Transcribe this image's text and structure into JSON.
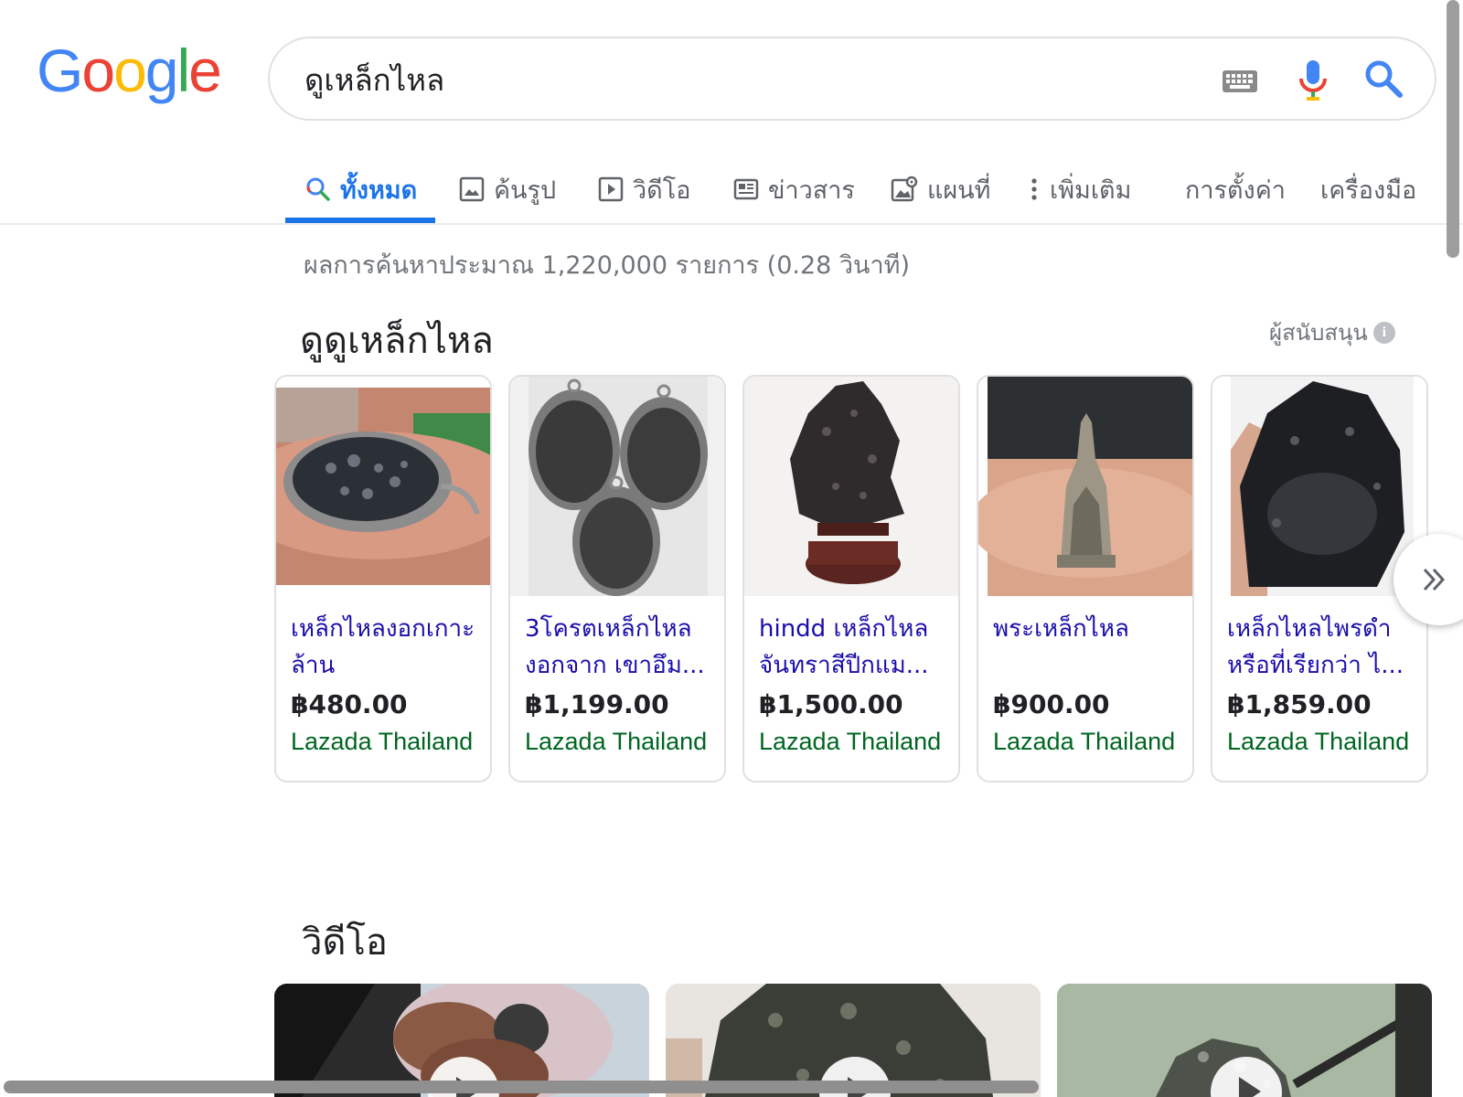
{
  "logo": {
    "letters": [
      "G",
      "o",
      "o",
      "g",
      "l",
      "e"
    ],
    "colors": [
      "#4285F4",
      "#EA4335",
      "#FBBC05",
      "#4285F4",
      "#34A853",
      "#EA4335"
    ]
  },
  "search": {
    "query": "ดูเหล็กไหล"
  },
  "tabs": [
    {
      "label": "ทั้งหมด",
      "icon": "search-icon",
      "active": true
    },
    {
      "label": "ค้นรูป",
      "icon": "image-icon"
    },
    {
      "label": "วิดีโอ",
      "icon": "video-icon"
    },
    {
      "label": "ข่าวสาร",
      "icon": "news-icon"
    },
    {
      "label": "แผนที่",
      "icon": "map-icon"
    },
    {
      "label": "เพิ่มเติม",
      "icon": "more-vert-icon"
    },
    {
      "label": "การตั้งค่า"
    },
    {
      "label": "เครื่องมือ"
    }
  ],
  "result_stats": "ผลการค้นหาประมาณ 1,220,000 รายการ (0.28 วินาที)",
  "shopping": {
    "heading": "ดูดูเหล็กไหล",
    "sponsored_label": "ผู้สนับสนุน",
    "products": [
      {
        "title": "เหล็กไหลงอกเกาะล้าน",
        "price": "฿480.00",
        "merchant": "Lazada Thailand"
      },
      {
        "title": "3โครตเหล็กไหล งอกจาก เขาอึม...",
        "price": "฿1,199.00",
        "merchant": "Lazada Thailand"
      },
      {
        "title": "hindd เหล็กไหล จันทราสีปีกแม...",
        "price": "฿1,500.00",
        "merchant": "Lazada Thailand"
      },
      {
        "title": "พระเหล็กไหล",
        "price": "฿900.00",
        "merchant": "Lazada Thailand"
      },
      {
        "title": "เหล็กไหลไพรดำ หรือที่เรียกว่า ไ...",
        "price": "฿1,859.00",
        "merchant": "Lazada Thailand"
      }
    ]
  },
  "videos": {
    "heading": "วิดีโอ",
    "count": 3
  },
  "colors": {
    "accent": "#1a73e8",
    "link": "#1a0dab",
    "merchant": "#006621"
  }
}
